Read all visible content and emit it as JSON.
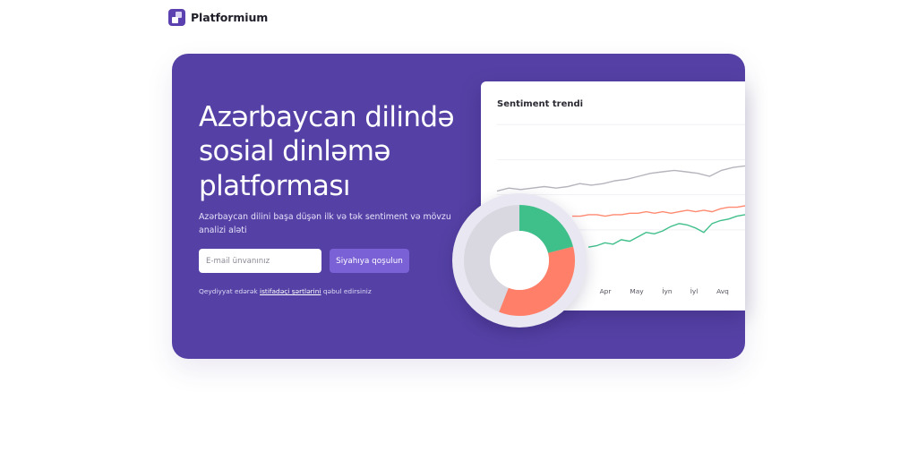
{
  "brand": {
    "name": "Platformium"
  },
  "hero": {
    "title_lines": [
      "Azərbaycan dilində",
      "sosial dinləmə",
      "platforması"
    ],
    "subtitle": "Azərbaycan dilini başa düşən ilk və tək sentiment və mövzu analizi aləti",
    "email_placeholder": "E-mail ünvanınız",
    "cta_label": "Siyahıya qoşulun",
    "terms_prefix": "Qeydiyyat edərək ",
    "terms_link": "istifadəçi şərtlərini",
    "terms_suffix": " qəbul edirsiniz"
  },
  "colors": {
    "hero_bg": "#5541a5",
    "accent": "#7a62d6",
    "neutral": "#d9d8e0",
    "negative": "#ff7f68",
    "positive": "#3fbf8a"
  },
  "chart_data": [
    {
      "type": "line",
      "title": "Sentiment trendi",
      "x": [
        "Apr",
        "May",
        "İyn",
        "İyl",
        "Avq"
      ],
      "series": [
        {
          "color": "#b5b5bd",
          "values": [
            50,
            52,
            51,
            52,
            53,
            52,
            53,
            55,
            54,
            55,
            57,
            58,
            60,
            62,
            63,
            64,
            63,
            62,
            60,
            64,
            66,
            67
          ]
        },
        {
          "color": "#ff8a70",
          "values": [
            33,
            33,
            34,
            34,
            33,
            34,
            34,
            35,
            35,
            36,
            35,
            36,
            35,
            36,
            37,
            36,
            37,
            36,
            38,
            39,
            39,
            40
          ]
        },
        {
          "color": "#3fbf8a",
          "values": [
            12,
            13,
            15,
            14,
            17,
            16,
            19,
            22,
            21,
            23,
            26,
            28,
            27,
            25,
            22,
            28,
            30,
            31,
            33,
            34
          ]
        }
      ]
    },
    {
      "type": "pie",
      "segments": [
        {
          "value": 21,
          "color": "#3fbf8a"
        },
        {
          "value": 35,
          "color": "#ff7f68"
        },
        {
          "value": 44,
          "color": "#d9d8e0"
        }
      ]
    }
  ]
}
